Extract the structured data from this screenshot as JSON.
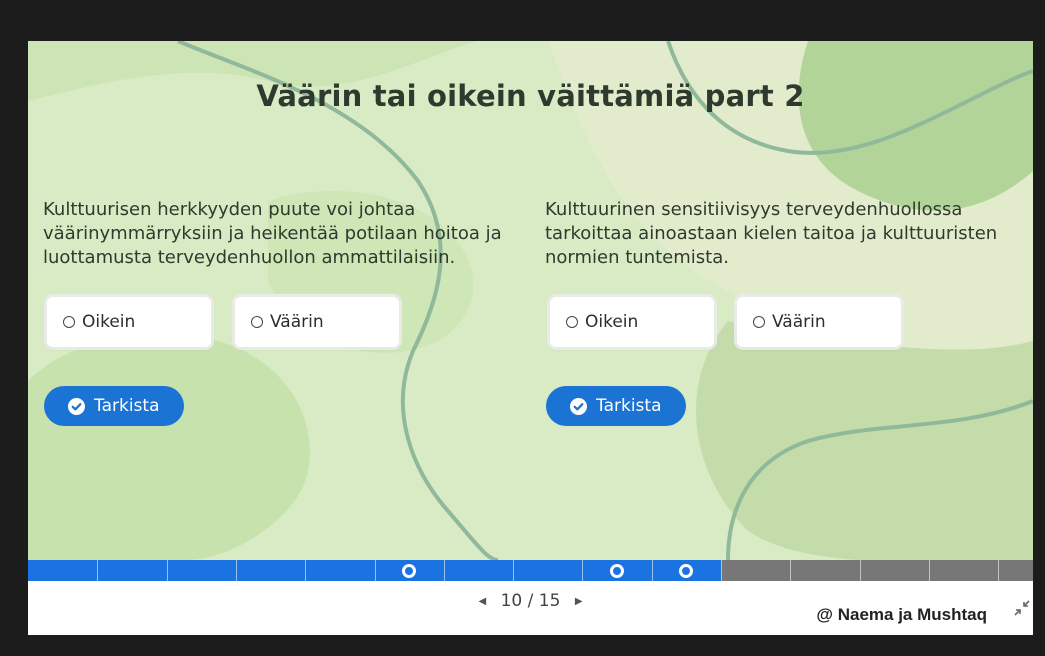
{
  "slide": {
    "title": "Väärin tai oikein väittämiä part 2",
    "questions": [
      {
        "text": "Kulttuurisen herkkyyden puute voi johtaa väärinymmärryksiin ja heikentää potilaan hoitoa ja luottamusta terveydenhuollon ammattilaisiin.",
        "options": [
          "Oikein",
          "Väärin"
        ],
        "check_label": "Tarkista"
      },
      {
        "text": "Kulttuurinen sensitiivisyys terveydenhuollossa tarkoittaa ainoastaan kielen taitoa ja kulttuuristen normien tuntemista.",
        "options": [
          "Oikein",
          "Väärin"
        ],
        "check_label": "Tarkista"
      }
    ]
  },
  "progress": {
    "current": 10,
    "total": 15,
    "markers": [
      6,
      9,
      10
    ]
  },
  "pager": {
    "label": "10 / 15",
    "prev_icon": "triangle-left-icon",
    "next_icon": "triangle-right-icon"
  },
  "footer": {
    "credit": "@ Naema ja Mushtaq",
    "collapse_icon": "collapse-icon"
  },
  "colors": {
    "accent": "#1a73e0",
    "button": "#1b73d3",
    "slide_bg": "#d9ebc4",
    "progress_remaining": "#777777"
  }
}
